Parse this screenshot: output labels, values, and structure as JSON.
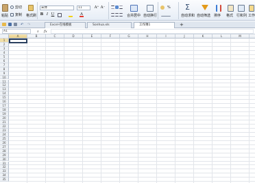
{
  "ribbon": {
    "cut_label": "剪切",
    "paste_label": "粘贴",
    "copy_label": "复制",
    "format_painter_label": "格式刷",
    "font_name": "宋体",
    "font_size": "11",
    "bold_label": "B",
    "italic_label": "I",
    "underline_label": "U",
    "increase_font_label": "A⁺",
    "decrease_font_label": "A⁻",
    "merge_center_label": "合并居中",
    "wrap_text_label": "自动换行",
    "number_format_label": "%",
    "sum_label": "自动求和",
    "auto_filter_label": "自动筛选",
    "sort_label": "排序",
    "format_label": "格式",
    "rows_cols_label": "行和列",
    "worksheet_label": "工作"
  },
  "tabs": [
    {
      "label": "Excel-在线模板"
    },
    {
      "label": "Sonhua.xls"
    },
    {
      "label": "工作簿1"
    }
  ],
  "formula_bar": {
    "cell_ref": "A1",
    "fx_label": "fx",
    "value": ""
  },
  "columns": [
    "A",
    "B",
    "C",
    "D",
    "E",
    "F",
    "G",
    "H",
    "I",
    "J",
    "K",
    "L",
    "M",
    "N"
  ],
  "rows": [
    "1",
    "2",
    "3",
    "4",
    "5",
    "6",
    "7",
    "8",
    "9",
    "10",
    "11",
    "12",
    "13",
    "14",
    "15",
    "16",
    "17",
    "18",
    "19",
    "20",
    "21",
    "22",
    "23",
    "24",
    "25",
    "26",
    "27",
    "28",
    "29",
    "30",
    "31",
    "32",
    "33",
    "34",
    "35"
  ]
}
